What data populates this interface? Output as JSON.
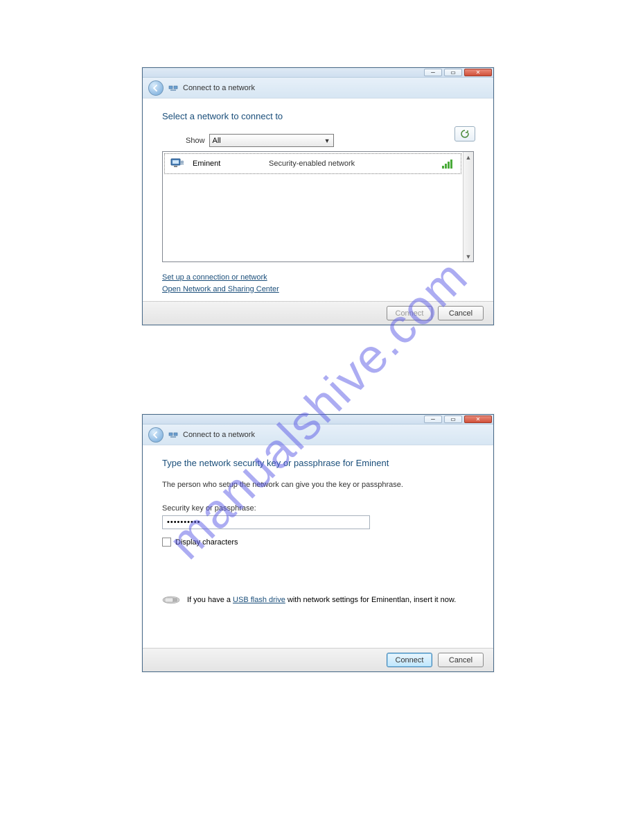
{
  "watermark": "manualshive.com",
  "window1": {
    "title": "Connect to a network",
    "heading": "Select a network to connect to",
    "show_label": "Show",
    "show_value": "All",
    "network": {
      "name": "Eminent",
      "desc": "Security-enabled network"
    },
    "link_setup": "Set up a connection or network",
    "link_center": "Open Network and Sharing Center",
    "btn_connect": "Connect",
    "btn_cancel": "Cancel"
  },
  "window2": {
    "title": "Connect to a network",
    "heading": "Type the network security key or passphrase for Eminent",
    "sub": "The person who setup the network can give you the key or passphrase.",
    "field_label": "Security key or passphrase:",
    "field_value": "••••••••••",
    "chk_label": "Display characters",
    "usb_prefix": "If you have a ",
    "usb_link": "USB flash drive",
    "usb_suffix": " with network settings for Eminentlan, insert it now.",
    "btn_connect": "Connect",
    "btn_cancel": "Cancel"
  }
}
